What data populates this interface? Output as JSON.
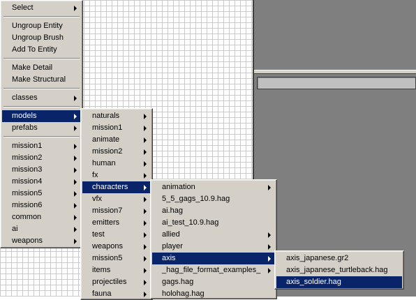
{
  "menu1": [
    {
      "t": "item",
      "label": "Select",
      "sub": true
    },
    {
      "t": "sep"
    },
    {
      "t": "item",
      "label": "Ungroup Entity"
    },
    {
      "t": "item",
      "label": "Ungroup Brush"
    },
    {
      "t": "item",
      "label": "Add To Entity"
    },
    {
      "t": "sep"
    },
    {
      "t": "item",
      "label": "Make Detail"
    },
    {
      "t": "item",
      "label": "Make Structural"
    },
    {
      "t": "sep"
    },
    {
      "t": "item",
      "label": "classes",
      "sub": true
    },
    {
      "t": "sep"
    },
    {
      "t": "item",
      "label": "models",
      "sub": true,
      "selected": true
    },
    {
      "t": "item",
      "label": "prefabs",
      "sub": true
    },
    {
      "t": "sep"
    },
    {
      "t": "item",
      "label": "mission1",
      "sub": true
    },
    {
      "t": "item",
      "label": "mission2",
      "sub": true
    },
    {
      "t": "item",
      "label": "mission3",
      "sub": true
    },
    {
      "t": "item",
      "label": "mission4",
      "sub": true
    },
    {
      "t": "item",
      "label": "mission5",
      "sub": true
    },
    {
      "t": "item",
      "label": "mission6",
      "sub": true
    },
    {
      "t": "item",
      "label": "common",
      "sub": true
    },
    {
      "t": "item",
      "label": "ai",
      "sub": true
    },
    {
      "t": "item",
      "label": "weapons",
      "sub": true
    }
  ],
  "menu2": [
    {
      "t": "item",
      "label": "naturals",
      "sub": true
    },
    {
      "t": "item",
      "label": "mission1",
      "sub": true
    },
    {
      "t": "item",
      "label": "animate",
      "sub": true
    },
    {
      "t": "item",
      "label": "mission2",
      "sub": true
    },
    {
      "t": "item",
      "label": "human",
      "sub": true
    },
    {
      "t": "item",
      "label": "fx",
      "sub": true
    },
    {
      "t": "item",
      "label": "characters",
      "sub": true,
      "selected": true
    },
    {
      "t": "item",
      "label": "vfx",
      "sub": true
    },
    {
      "t": "item",
      "label": "mission7",
      "sub": true
    },
    {
      "t": "item",
      "label": "emitters",
      "sub": true
    },
    {
      "t": "item",
      "label": "test",
      "sub": true
    },
    {
      "t": "item",
      "label": "weapons",
      "sub": true
    },
    {
      "t": "item",
      "label": "mission5",
      "sub": true
    },
    {
      "t": "item",
      "label": "items",
      "sub": true
    },
    {
      "t": "item",
      "label": "projectiles",
      "sub": true
    },
    {
      "t": "item",
      "label": "fauna",
      "sub": true
    }
  ],
  "menu3": [
    {
      "t": "item",
      "label": "animation",
      "sub": true
    },
    {
      "t": "item",
      "label": "5_5_gags_10.9.hag"
    },
    {
      "t": "item",
      "label": "ai.hag"
    },
    {
      "t": "item",
      "label": "ai_test_10.9.hag"
    },
    {
      "t": "item",
      "label": "allied",
      "sub": true
    },
    {
      "t": "item",
      "label": "player",
      "sub": true
    },
    {
      "t": "item",
      "label": "axis",
      "sub": true,
      "selected": true
    },
    {
      "t": "item",
      "label": "_hag_file_format_examples_",
      "sub": true
    },
    {
      "t": "item",
      "label": "gags.hag"
    },
    {
      "t": "item",
      "label": "holohag.hag"
    }
  ],
  "menu4": [
    {
      "t": "item",
      "label": "axis_japanese.gr2"
    },
    {
      "t": "item",
      "label": "axis_japanese_turtleback.hag"
    },
    {
      "t": "item",
      "label": "axis_soldier.hag",
      "selected": true
    }
  ],
  "colors": {
    "menu_bg": "#d4d0c8",
    "highlight": "#0a246a",
    "pane": "#7f7f7f"
  }
}
